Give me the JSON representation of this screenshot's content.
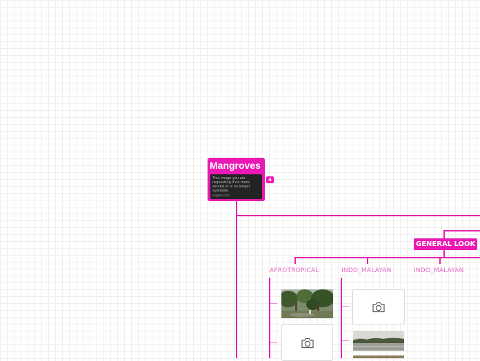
{
  "root": {
    "title": "Mangroves",
    "image_caption": "This image you are requesting if no more served or is no longer available.",
    "image_logo": "imgbox.com",
    "child_count": "4"
  },
  "branch": {
    "label": "GENERAL LOOK"
  },
  "subtopics": [
    {
      "label": "AFROTROPICAL"
    },
    {
      "label": "INDO_MALAYAN"
    },
    {
      "label": "INDO_MALAYAN"
    }
  ],
  "icons": {
    "image_placeholder": "camera-icon"
  },
  "colors": {
    "accent": "#ea18b4",
    "line": "#e820b0",
    "sub_label": "#e86ac8",
    "grid": "#eeeeee"
  }
}
